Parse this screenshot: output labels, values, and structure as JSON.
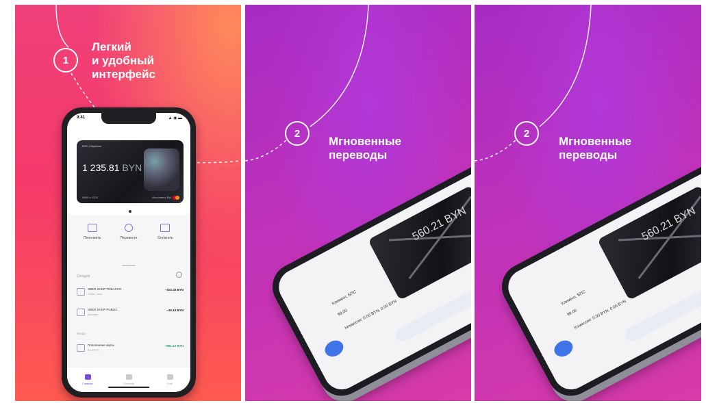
{
  "panels": [
    {
      "step": "1",
      "headline": [
        "Легкий",
        "и удобный",
        "интерфейс"
      ],
      "phone": {
        "status_time": "9:41",
        "status_right": "▲ ◉ ▬",
        "card": {
          "bank_label": "БПС-Сбербанк",
          "balance_main": "1 235.81",
          "balance_currency": "BYN",
          "footer_left": "5469 •• 1225",
          "footer_right": "Исполнено ВЫ"
        },
        "actions": [
          "Пополнить",
          "Перевести",
          "Оплатить"
        ],
        "history_title": "Сегодня",
        "rows": [
          {
            "title": "SBER SHOP TOBACCO",
            "sub": "Табак, чеки",
            "amount": "−102.43 BYN",
            "positive": false
          },
          {
            "title": "SBER SHOP PUBLIC",
            "sub": "Магазин",
            "amount": "−36.18 BYN",
            "positive": false
          },
          {
            "title": "Пополнение карты",
            "sub": "Из ЕРИП",
            "amount": "+881.12 BYN",
            "positive": true
          }
        ],
        "yesterday": "Вчера",
        "tabs": [
          "Главная",
          "Платежи",
          "Ещё"
        ]
      }
    },
    {
      "step": "2",
      "headline": [
        "Мгновенные",
        "переводы"
      ],
      "phone": {
        "card_amount": "560.21 BYN",
        "lines": [
          "Климент, БПС",
          "99.00",
          "Комиссия: 0.00 BYN, 0.00 BYN"
        ]
      }
    },
    {
      "step": "2",
      "headline": [
        "Мгновенные",
        "переводы"
      ],
      "phone": {
        "card_amount": "560.21 BYN",
        "lines": [
          "Климент, БПС",
          "99.00",
          "Комиссия: 0.00 BYN, 0.00 BYN"
        ]
      }
    }
  ],
  "colors": {
    "panel1_top": "#f0407a",
    "panel1_bottom": "#ff5a50",
    "panel23": "#b030c8",
    "accent": "#7c4ddb",
    "button_blue": "#3f73e8"
  }
}
